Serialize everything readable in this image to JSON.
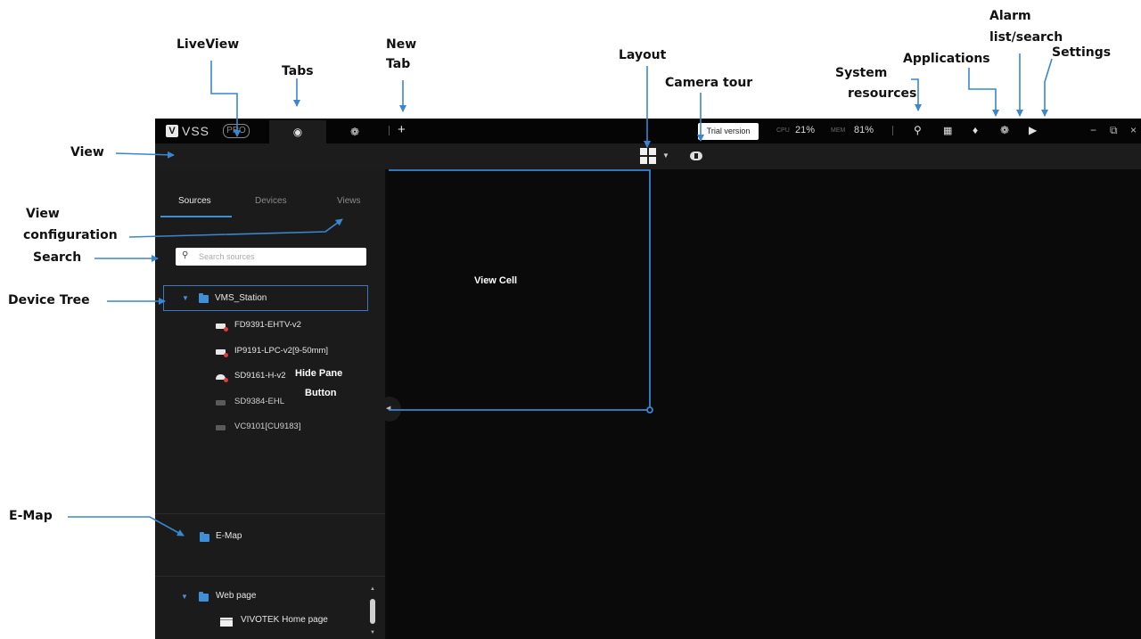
{
  "app": {
    "logo_mark": "V",
    "logo_text": "VSS",
    "logo_badge": "PRO",
    "new_tab": "+",
    "trial_label": "Trial version",
    "cpu_label": "CPU",
    "cpu_value": "21%",
    "mem_label": "MEM",
    "mem_value": "81%",
    "window_controls": [
      "−",
      "⧉",
      "×"
    ]
  },
  "sidebar": {
    "tabs": [
      "Sources",
      "Devices",
      "Views"
    ],
    "active_tab": "Sources",
    "search_placeholder": "Search sources",
    "tree": {
      "root": "VMS_Station",
      "devices": [
        "FD9391-EHTV-v2",
        "IP9191-LPC-v2[9-50mm]",
        "SD9161-H-v2",
        "SD9384-EHL",
        "VC9101[CU9183]"
      ]
    },
    "emap": "E-Map",
    "web_folder": "Web page",
    "web_item": "VIVOTEK Home page"
  },
  "annotations": {
    "liveview": "LiveView",
    "tabs": "Tabs",
    "new_tab_line1": "New",
    "new_tab_line2": "Tab",
    "layout": "Layout",
    "camera_tour": "Camera tour",
    "system_line1": "System",
    "system_line2": "resources",
    "applications": "Applications",
    "alarm_line1": "Alarm",
    "alarm_line2": "list/search",
    "settings": "Settings",
    "view": "View",
    "view_config_line1": "View",
    "view_config_line2": "configuration",
    "search": "Search",
    "device_tree": "Device Tree",
    "view_cell": "View Cell",
    "hide_pane_line1": "Hide Pane",
    "hide_pane_line2": "Button",
    "emap": "E-Map"
  },
  "colors": {
    "accent_blue": "#3f8ed8",
    "annotation_arrow": "#3a86d0",
    "alert_red": "#e23b3b",
    "app_background": "#0b0b0b"
  },
  "icons": [
    "eye-icon",
    "gear-icon",
    "search-icon",
    "grid-apps-icon",
    "bell-icon",
    "speaker-icon",
    "layout-grid-icon",
    "camera-tour-icon",
    "folder-icon",
    "camera-icon",
    "collapse-arrow-icon"
  ]
}
